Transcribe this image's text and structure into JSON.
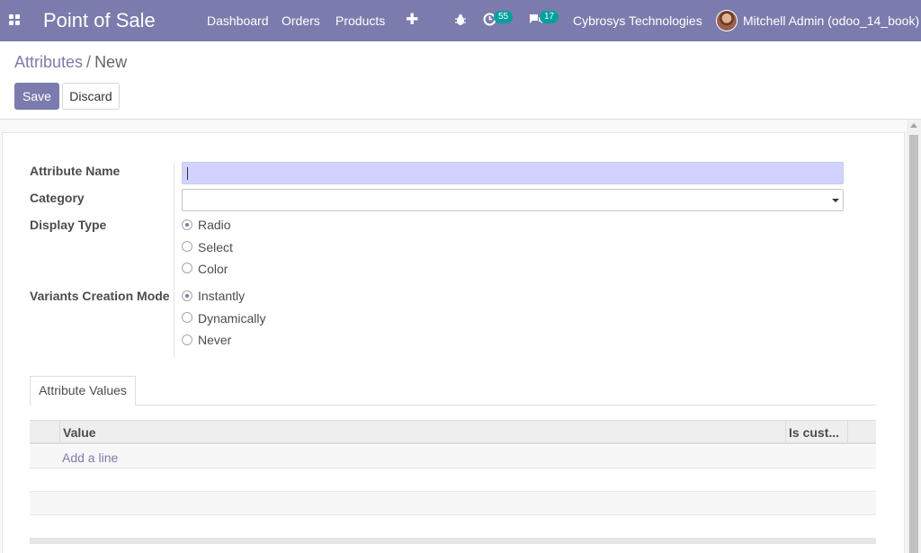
{
  "navbar": {
    "app_title": "Point of Sale",
    "menu": [
      "Dashboard",
      "Orders",
      "Products"
    ],
    "plus": "✚",
    "activity_count": "55",
    "message_count": "17",
    "company": "Cybrosys Technologies",
    "user": "Mitchell Admin (odoo_14_book)",
    "colors": {
      "brand": "#7c7bad",
      "badge": "#00a09d"
    }
  },
  "breadcrumb": {
    "parent": "Attributes",
    "separator": "/",
    "current": "New"
  },
  "buttons": {
    "save": "Save",
    "discard": "Discard"
  },
  "form": {
    "attribute_name": {
      "label": "Attribute Name",
      "value": ""
    },
    "category": {
      "label": "Category",
      "value": ""
    },
    "display_type": {
      "label": "Display Type",
      "options": [
        "Radio",
        "Select",
        "Color"
      ],
      "selected": "Radio"
    },
    "variants_creation_mode": {
      "label": "Variants Creation Mode",
      "options": [
        "Instantly",
        "Dynamically",
        "Never"
      ],
      "selected": "Instantly"
    }
  },
  "notebook": {
    "tab": "Attribute Values",
    "columns": [
      "Value",
      "Is cust..."
    ],
    "add_line": "Add a line"
  }
}
